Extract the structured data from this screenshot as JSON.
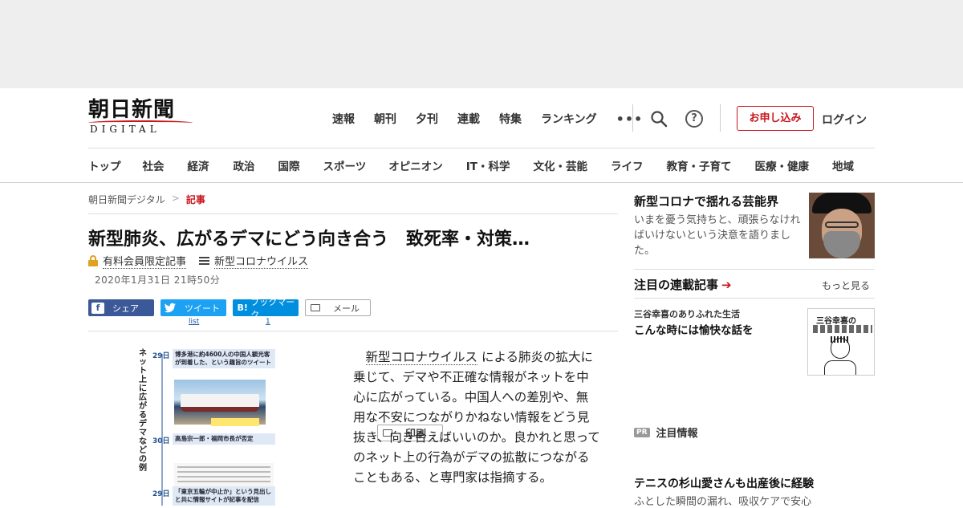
{
  "logo": {
    "kanji": "朝日新聞",
    "sub": "DIGITAL"
  },
  "topnav": [
    "速報",
    "朝刊",
    "夕刊",
    "連載",
    "特集",
    "ランキング"
  ],
  "topnav_more": "•••",
  "help_glyph": "?",
  "subscribe_label": "お申し込み",
  "login_label": "ログイン",
  "categories": [
    "トップ",
    "社会",
    "経済",
    "政治",
    "国際",
    "スポーツ",
    "オピニオン",
    "IT・科学",
    "文化・芸能",
    "ライフ",
    "教育・子育て",
    "医療・健康",
    "地域"
  ],
  "breadcrumb": {
    "home": "朝日新聞デジタル",
    "sep": ">",
    "current": "記事"
  },
  "article": {
    "headline": "新型肺炎、広がるデマにどう向き合う　致死率・対策…",
    "member_label": "有料会員限定記事",
    "topic_label": "新型コロナウイルス",
    "date": "2020年1月31日 21時50分",
    "body_keyword": "新型コロナウイルス",
    "body_rest": "による肺炎の拡大に乗じて、デマや不正確な情報がネットを中心に広がっている。中国人への差別や、無用な不安につながりかねない情報をどう見抜き、向き合えばいいのか。良かれと思ってのネット上の行為がデマの拡散につながることもある、と専門家は指摘する。"
  },
  "share": {
    "facebook": "シェア",
    "facebook_icon": "f",
    "twitter": "ツイート",
    "twitter_count": "list",
    "hatena": "ブックマーク",
    "hatena_icon": "B!",
    "hatena_count": "1",
    "mail": "メール",
    "print": "印刷"
  },
  "figure": {
    "vertical_title": "ネット上に広がるデマなどの例",
    "day1": "29日",
    "caption1": "博多港に約4600人の中国人観光客が到着した、という趣旨のツイート",
    "day2": "30日",
    "caption2": "高島宗一郎・福岡市長が否定",
    "day3": "29日",
    "caption3": "「東京五輪が中止か」という見出しと共に情報サイトが記事を配信"
  },
  "sidebar": {
    "featured_title": "新型コロナで揺れる芸能界",
    "featured_desc": "いまを憂う気持ちと、頑張らなければいけないという決意を語りました。",
    "series_heading": "注目の連載記事",
    "series_more": "もっと見る",
    "series_column": "三谷幸喜のありふれた生活",
    "series_title": "こんな時には愉快な話を",
    "series_img_title": "三谷幸喜の",
    "pr_badge": "PR",
    "pr_heading": "注目情報",
    "pr_title": "テニスの杉山愛さんも出産後に経験",
    "pr_desc": "ふとした瞬間の漏れ、吸収ケアで安心"
  },
  "colors": {
    "accent": "#c8161d",
    "facebook": "#3b5998",
    "twitter": "#1da1f2",
    "hatena": "#008fde"
  }
}
